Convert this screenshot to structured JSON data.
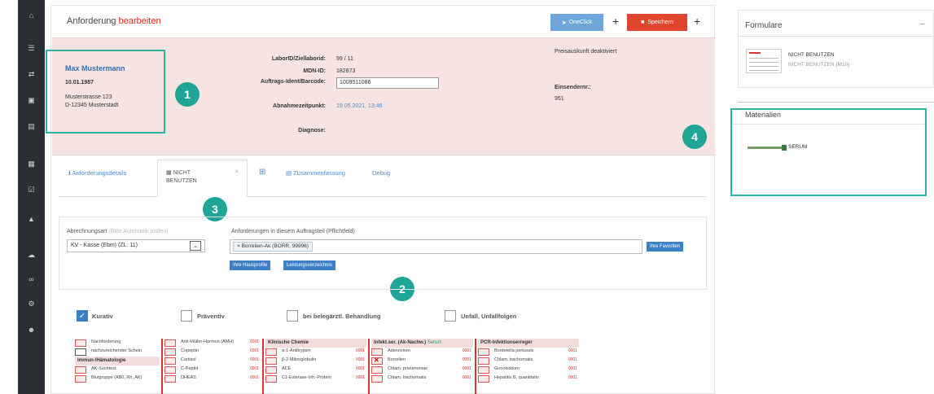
{
  "header": {
    "title_prefix": "Anforderung",
    "title_accent": "bearbeiten",
    "oneclick_label": "OneClick",
    "save_label": "Speichern",
    "plus_glyph": "+"
  },
  "patient": {
    "name": "Max Mustermann",
    "dob": "10.01.1987",
    "street": "Musterstrasse 123",
    "city": "D-12345 Musterstadt"
  },
  "order": {
    "labid_label": "LaborID/Ziellaborid:",
    "labid_value": "99 / 11",
    "mdn_label": "MDN-ID:",
    "mdn_value": "182873",
    "barcode_label": "Auftrags-Ident/Barcode:",
    "barcode_value": "1009511086",
    "sampling_label": "Abnahmezeitpunkt:",
    "sampling_value": "19.05.2021, 13:46",
    "diagnosis_label": "Diagnose:",
    "price_info": "Preisauskunft deaktiviert",
    "sender_label": "Einsendernr.:",
    "sender_value": "951"
  },
  "markers": [
    "1",
    "2",
    "3",
    "4"
  ],
  "tabs": {
    "details": "Anforderungsdetails",
    "active_line1": "NICHT",
    "active_line2": "BENUTZEN",
    "active_close": "×",
    "summary": "Zusammenfassung",
    "debug": "Debug"
  },
  "billing": {
    "type_label": "Abrechnungsart",
    "type_hint": "(Bitte Automatik prüfen)",
    "type_value": "KV - Kasse (Ebm) (ZL: 11)",
    "requests_label": "Anforderungen in diesem Auftragsteil (Pflichtfeld)",
    "selected_tag": "× Borrelien-Ak (BORR, 99996)",
    "favorites_button": "Ihre Favoriten",
    "profiles_button": "Ihre Hausprofile",
    "services_button": "Leistungsverzeichnis"
  },
  "checkboxes": [
    {
      "label": "Kurativ",
      "checked": true
    },
    {
      "label": "Präventiv",
      "checked": false
    },
    {
      "label": "bei belegärztl. Behandlung",
      "checked": false
    },
    {
      "label": "Unfall, Unfallfolgen",
      "checked": false
    }
  ],
  "grid": {
    "col1": [
      "Nachforderung",
      "nachzureichender Schein",
      "Immun-/Hämatologie",
      "AK-Suchtest",
      "Blutgruppe (AB0, Rh, AK)"
    ],
    "col2": [
      "Anti-Müller-Hormon (AMH)",
      "Copeptin",
      "Cortisol",
      "C-Peptid",
      "DHEAS"
    ],
    "col3_header": "Klinische Chemie",
    "col3": [
      "α-1-Antitrypsin",
      "β-2-Mikroglobulin",
      "ACE",
      "C1-Esterase-Inh.-Protein"
    ],
    "col4_header": "Infekt.ser. (Ak-Nachw.)",
    "col4_extra": "Serum",
    "col4": [
      "Adenoviren",
      "Borrelien",
      "Chlam. pneumoniae",
      "Chlam. trachomatis"
    ],
    "col5_header": "PCR-Infektionserreger",
    "col5": [
      "Bordetella pertussis",
      "Chlam. trachomatis",
      "Gonokokken",
      "Hepatitis B, quantitativ"
    ],
    "code": "0001"
  },
  "right": {
    "forms_title": "Formulare",
    "forms_collapse": "–",
    "form_name": "NICHT BENUTZEN",
    "form_sub": "NICHT BENUTZEN (M10)",
    "materials_title": "Materialien",
    "material_name": "SERUM"
  },
  "colors": {
    "accent_red": "#d9261c",
    "header_pink": "#f7e4e2",
    "callout_teal": "#2fb3a4",
    "link_blue": "#4a8ccf"
  }
}
